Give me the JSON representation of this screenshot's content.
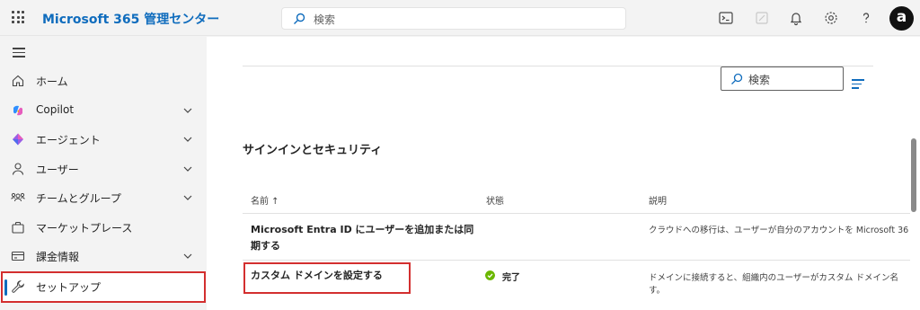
{
  "header": {
    "app_title": "Microsoft 365 管理センター",
    "search_placeholder": "検索",
    "avatar_initial": "a"
  },
  "sidebar": {
    "items": [
      {
        "label": "ホーム",
        "icon": "home-icon",
        "expandable": false
      },
      {
        "label": "Copilot",
        "icon": "copilot-icon",
        "expandable": true
      },
      {
        "label": "エージェント",
        "icon": "agent-icon",
        "expandable": true
      },
      {
        "label": "ユーザー",
        "icon": "user-icon",
        "expandable": true
      },
      {
        "label": "チームとグループ",
        "icon": "team-icon",
        "expandable": true
      },
      {
        "label": "マーケットプレース",
        "icon": "bag-icon",
        "expandable": false
      },
      {
        "label": "課金情報",
        "icon": "billing-icon",
        "expandable": true
      },
      {
        "label": "セットアップ",
        "icon": "wrench-icon",
        "expandable": false,
        "active": true
      }
    ]
  },
  "main": {
    "search_placeholder": "検索",
    "section_title": "サインインとセキュリティ",
    "columns": {
      "name": "名前 ↑",
      "status": "状態",
      "description": "説明"
    },
    "rows": [
      {
        "name_line1": "Microsoft Entra ID にユーザーを追加または同",
        "name_line2": "期する",
        "status": "",
        "desc_line1": "クラウドへの移行は、ユーザーが自分のアカウントを Microsoft 36",
        "desc_line2": ""
      },
      {
        "name_line1": "カスタム ドメインを設定する",
        "name_line2": "",
        "status": "完了",
        "desc_line1": "ドメインに接続すると、組織内のユーザーがカスタム ドメイン名",
        "desc_line2": "す。"
      }
    ]
  },
  "colors": {
    "accent": "#0f6cbd",
    "highlight_box": "#d32f2f",
    "status_done": "#6bb700"
  }
}
